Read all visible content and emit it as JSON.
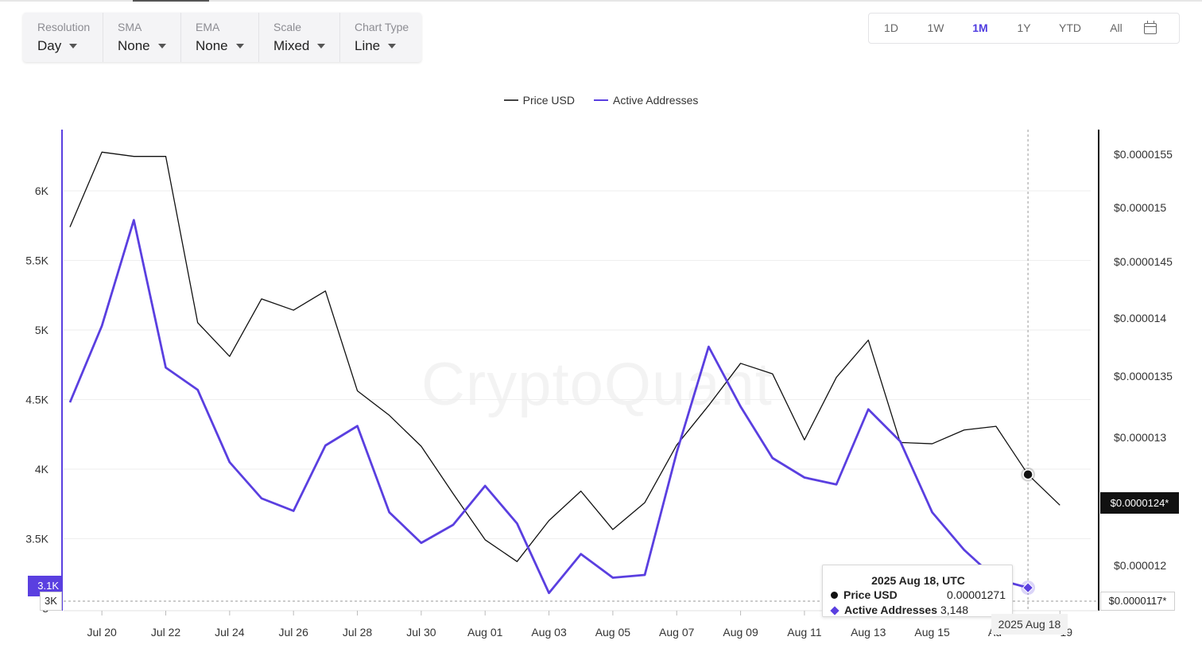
{
  "toolbar": {
    "resolution": {
      "label": "Resolution",
      "value": "Day"
    },
    "sma": {
      "label": "SMA",
      "value": "None"
    },
    "ema": {
      "label": "EMA",
      "value": "None"
    },
    "scale": {
      "label": "Scale",
      "value": "Mixed"
    },
    "chart_type": {
      "label": "Chart Type",
      "value": "Line"
    }
  },
  "ranges": {
    "buttons": [
      "1D",
      "1W",
      "1M",
      "1Y",
      "YTD",
      "All"
    ],
    "active": "1M"
  },
  "watermark": "CryptoQuant",
  "colors": {
    "price": "#111111",
    "active_addresses": "#5a3fe0",
    "accent": "#4f3ce0"
  },
  "tooltip": {
    "title": "2025 Aug 18, UTC",
    "price_label": "Price USD",
    "price_value": "0.00001271",
    "aa_label": "Active Addresses",
    "aa_value": "3,148"
  },
  "crosshair": {
    "date_label": "2025 Aug 18",
    "price_label": "$0.0000124*",
    "price_label_2": "$0.0000117*",
    "aa_label": "3.1K",
    "aa_label_2": "3K"
  },
  "chart_data": {
    "type": "line",
    "legend": [
      "Price USD",
      "Active Addresses"
    ],
    "x": [
      "2025-07-19",
      "2025-07-20",
      "2025-07-21",
      "2025-07-22",
      "2025-07-23",
      "2025-07-24",
      "2025-07-25",
      "2025-07-26",
      "2025-07-27",
      "2025-07-28",
      "2025-07-29",
      "2025-07-30",
      "2025-07-31",
      "2025-08-01",
      "2025-08-02",
      "2025-08-03",
      "2025-08-04",
      "2025-08-05",
      "2025-08-06",
      "2025-08-07",
      "2025-08-08",
      "2025-08-09",
      "2025-08-10",
      "2025-08-11",
      "2025-08-12",
      "2025-08-13",
      "2025-08-14",
      "2025-08-15",
      "2025-08-16",
      "2025-08-17",
      "2025-08-18",
      "2025-08-19"
    ],
    "x_tick_labels": [
      "Jul 20",
      "Jul 22",
      "Jul 24",
      "Jul 26",
      "Jul 28",
      "Jul 30",
      "Aug 01",
      "Aug 03",
      "Aug 05",
      "Aug 07",
      "Aug 09",
      "Aug 11",
      "Aug 13",
      "Aug 15",
      "Au",
      "19"
    ],
    "series": [
      {
        "name": "Price USD",
        "axis": "right",
        "values": [
          1.482e-05,
          1.552e-05,
          1.548e-05,
          1.548e-05,
          1.396e-05,
          1.367e-05,
          1.417e-05,
          1.407e-05,
          1.424e-05,
          1.338e-05,
          1.318e-05,
          1.293e-05,
          1.256e-05,
          1.22e-05,
          1.203e-05,
          1.235e-05,
          1.258e-05,
          1.228e-05,
          1.249e-05,
          1.294e-05,
          1.326e-05,
          1.361e-05,
          1.352e-05,
          1.298e-05,
          1.349e-05,
          1.381e-05,
          1.296e-05,
          1.295e-05,
          1.306e-05,
          1.309e-05,
          1.271e-05,
          1.247e-05
        ]
      },
      {
        "name": "Active Addresses",
        "axis": "left",
        "values": [
          4480,
          5030,
          5790,
          4730,
          4570,
          4050,
          3790,
          3700,
          4170,
          4310,
          3690,
          3470,
          3600,
          3880,
          3610,
          3110,
          3390,
          3220,
          3240,
          4120,
          4880,
          4450,
          4080,
          3940,
          3890,
          4430,
          4200,
          3690,
          3420,
          3210,
          3148,
          null
        ]
      }
    ],
    "y_left": {
      "ticks": [
        3000,
        3500,
        4000,
        4500,
        5000,
        5500,
        6000
      ],
      "tick_labels": [
        "3",
        "3.5K",
        "4K",
        "4.5K",
        "5K",
        "5.5K",
        "6K"
      ]
    },
    "y_right": {
      "ticks": [
        1.2e-05,
        1.3e-05,
        1.35e-05,
        1.4e-05,
        1.45e-05,
        1.5e-05,
        1.55e-05
      ],
      "tick_labels": [
        "$0.000012",
        "$0.000013",
        "$0.0000135",
        "$0.000014",
        "$0.0000145",
        "$0.000015",
        "$0.0000155"
      ],
      "scale": "mixed"
    },
    "grid": true,
    "legend_position": "top-center"
  }
}
